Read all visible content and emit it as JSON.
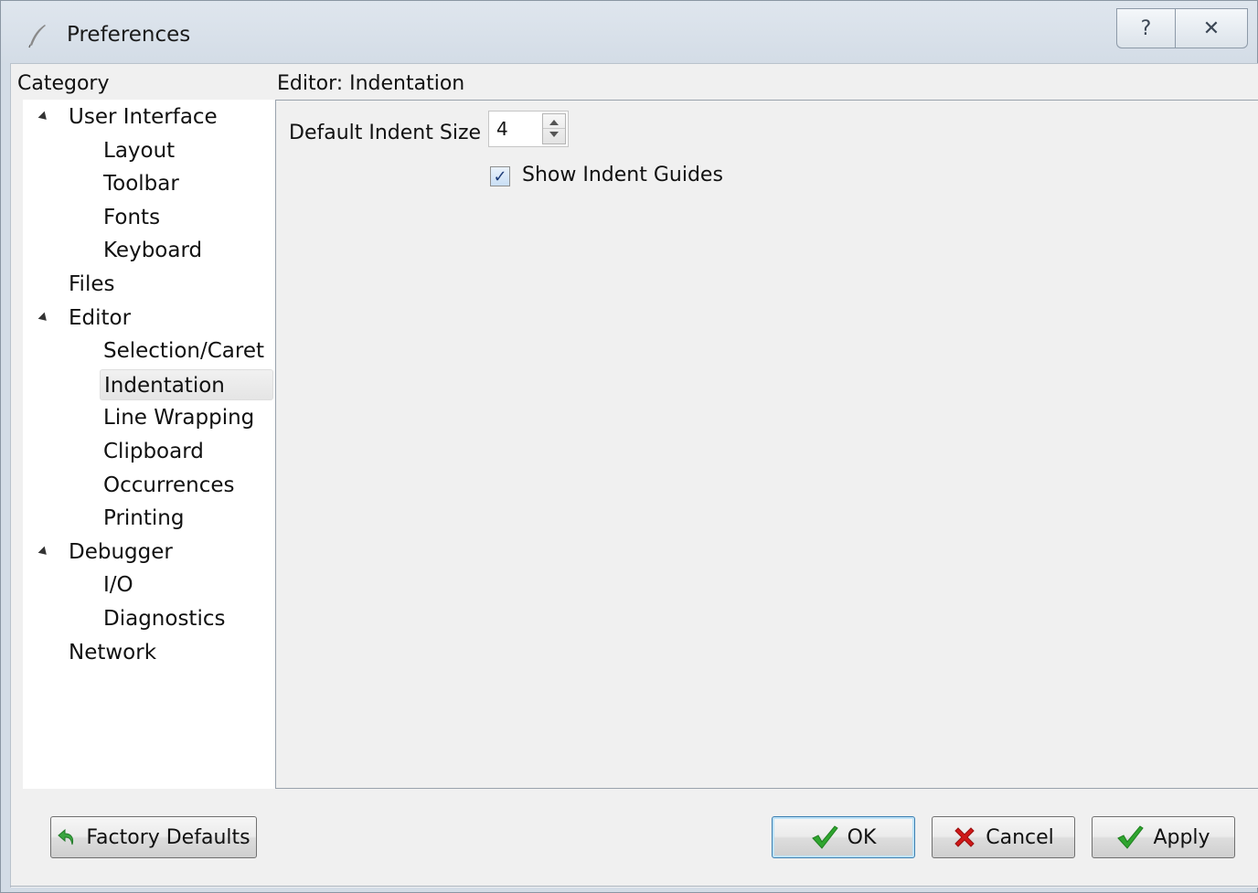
{
  "window": {
    "title": "Preferences"
  },
  "caption": {
    "help_glyph": "?",
    "close_glyph": "✕"
  },
  "category": {
    "header": "Category",
    "items": [
      {
        "label": "User Interface",
        "level": 0,
        "expanded": true
      },
      {
        "label": "Layout",
        "level": 1
      },
      {
        "label": "Toolbar",
        "level": 1
      },
      {
        "label": "Fonts",
        "level": 1
      },
      {
        "label": "Keyboard",
        "level": 1
      },
      {
        "label": "Files",
        "level": 0
      },
      {
        "label": "Editor",
        "level": 0,
        "expanded": true
      },
      {
        "label": "Selection/Caret",
        "level": 1
      },
      {
        "label": "Indentation",
        "level": 1,
        "selected": true
      },
      {
        "label": "Line Wrapping",
        "level": 1
      },
      {
        "label": "Clipboard",
        "level": 1
      },
      {
        "label": "Occurrences",
        "level": 1
      },
      {
        "label": "Printing",
        "level": 1
      },
      {
        "label": "Debugger",
        "level": 0,
        "expanded": true
      },
      {
        "label": "I/O",
        "level": 1
      },
      {
        "label": "Diagnostics",
        "level": 1
      },
      {
        "label": "Network",
        "level": 0
      }
    ]
  },
  "panel": {
    "header": "Editor: Indentation",
    "indent_size_label": "Default Indent Size",
    "indent_size_value": "4",
    "show_guides_label": "Show Indent Guides",
    "show_guides_checked": true
  },
  "buttons": {
    "factory_defaults": "Factory Defaults",
    "ok": "OK",
    "cancel": "Cancel",
    "apply": "Apply"
  },
  "colors": {
    "check_green": "#2fa52f",
    "cancel_red": "#d01818",
    "factory_green": "#3aa640"
  }
}
